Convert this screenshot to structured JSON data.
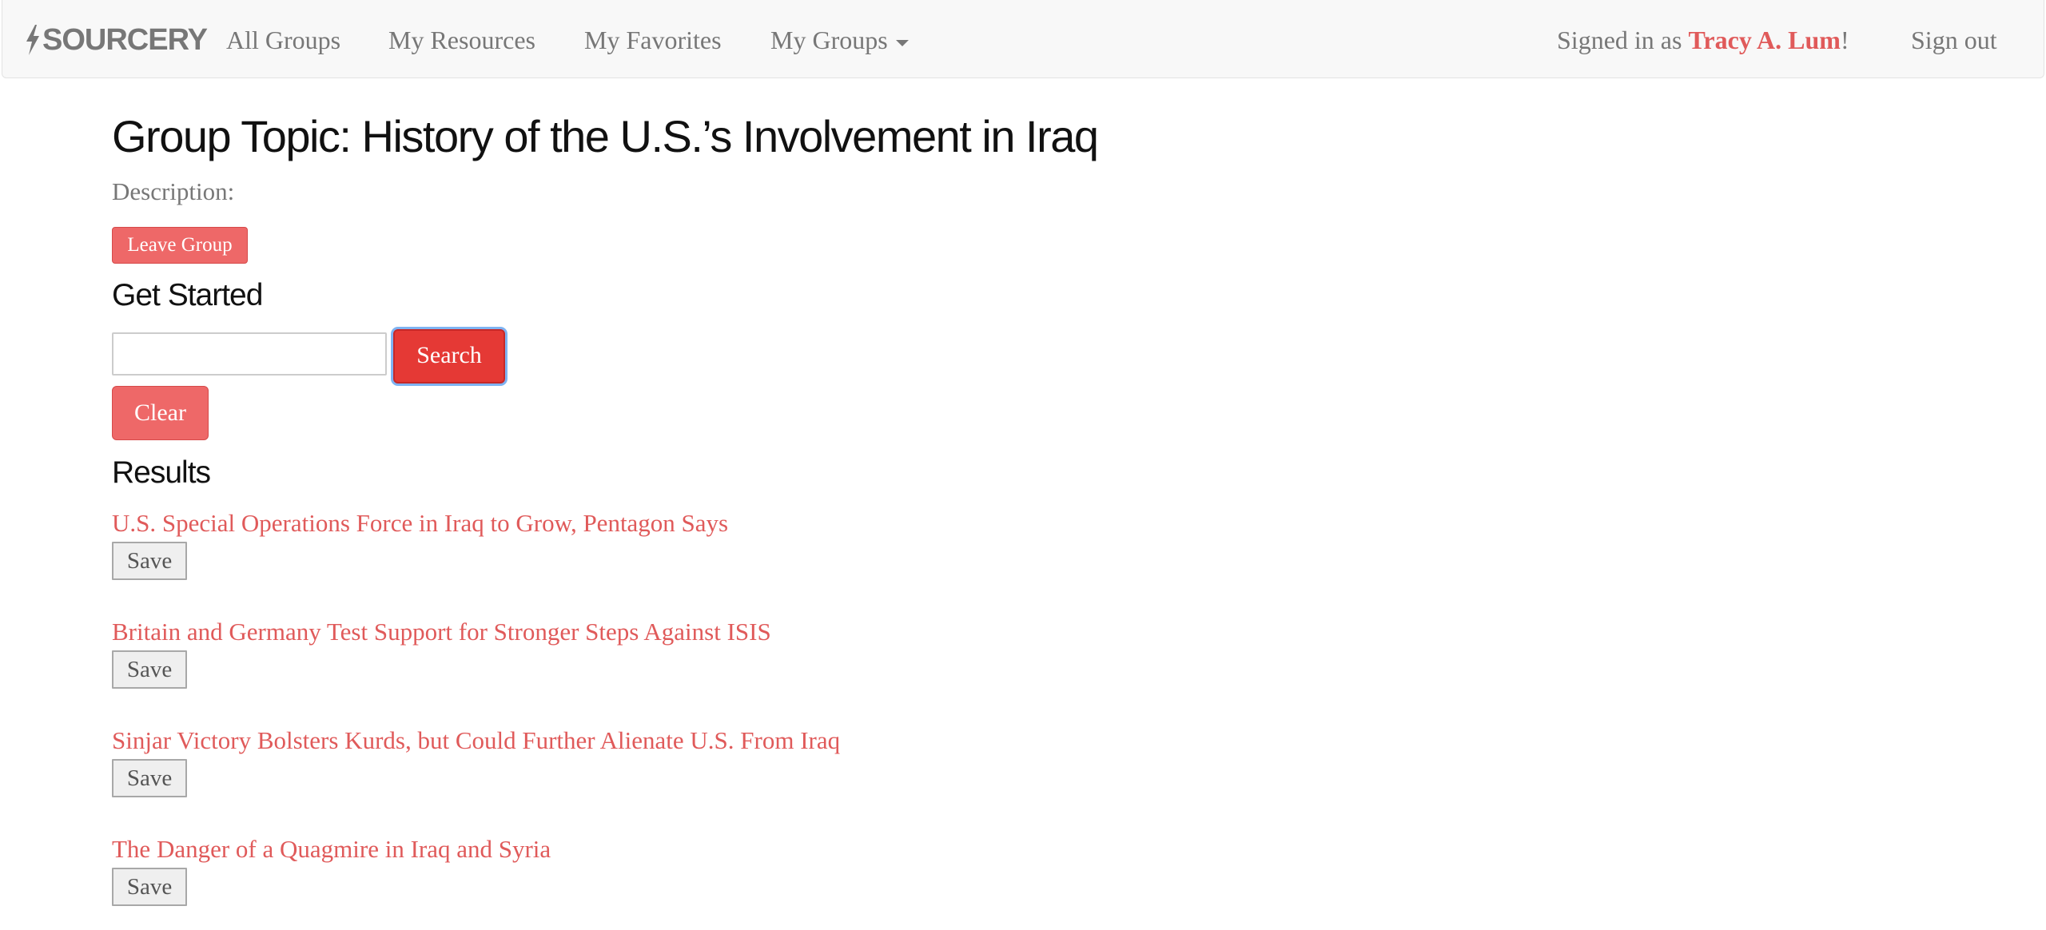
{
  "navbar": {
    "brand": "SOURCERY",
    "brand_icon": "lightning-bolt-icon",
    "links": [
      "All Groups",
      "My Resources",
      "My Favorites",
      "My Groups"
    ],
    "signed_in_prefix": "Signed in as ",
    "user_name": "Tracy A. Lum",
    "signed_in_suffix": "!",
    "sign_out": "Sign out"
  },
  "page": {
    "title": "Group Topic: History of the U.S.’s Involvement in Iraq",
    "description_label": "Description:",
    "leave_button": "Leave Group",
    "get_started_heading": "Get Started",
    "search_value": "",
    "search_button": "Search",
    "clear_button": "Clear",
    "results_heading": "Results"
  },
  "results": [
    {
      "title": "U.S. Special Operations Force in Iraq to Grow, Pentagon Says",
      "save_label": "Save"
    },
    {
      "title": "Britain and Germany Test Support for Stronger Steps Against ISIS",
      "save_label": "Save"
    },
    {
      "title": "Sinjar Victory Bolsters Kurds, but Could Further Alienate U.S. From Iraq",
      "save_label": "Save"
    },
    {
      "title": "The Danger of a Quagmire in Iraq and Syria",
      "save_label": "Save"
    }
  ],
  "colors": {
    "accent": "#e05a5a",
    "button_red": "#ee6868",
    "search_red": "#e53935",
    "navbar_bg": "#f8f8f8"
  }
}
